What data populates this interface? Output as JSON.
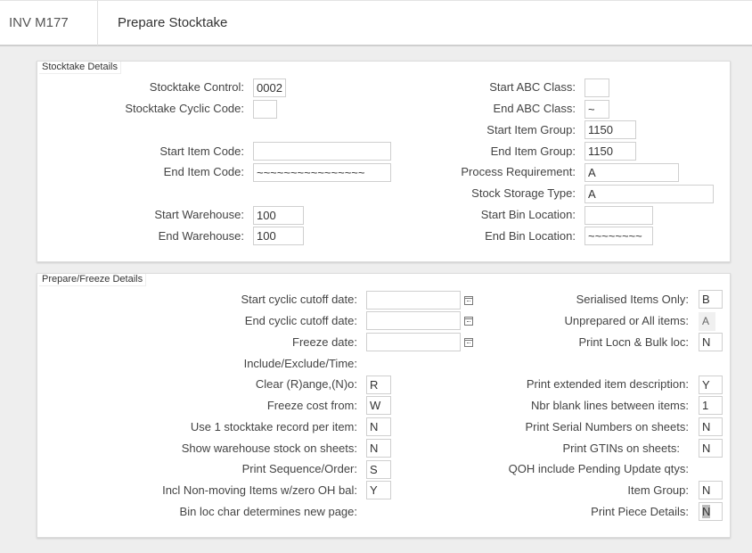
{
  "header": {
    "code": "INV M177",
    "title": "Prepare Stocktake"
  },
  "stocktake": {
    "legend": "Stocktake Details",
    "control_label": "Stocktake Control:",
    "control_value": "0002",
    "cyclic_label": "Stocktake Cyclic Code:",
    "cyclic_value": "",
    "start_item_label": "Start Item Code:",
    "start_item_value": "",
    "end_item_label": "End Item Code:",
    "end_item_value": "~~~~~~~~~~~~~~~~",
    "start_wh_label": "Start Warehouse:",
    "start_wh_value": "100",
    "end_wh_label": "End Warehouse:",
    "end_wh_value": "100",
    "start_abc_label": "Start ABC Class:",
    "start_abc_value": "",
    "end_abc_label": "End ABC Class:",
    "end_abc_value": "~",
    "start_group_label": "Start Item Group:",
    "start_group_value": "1150",
    "end_group_label": "End Item Group:",
    "end_group_value": "1150",
    "process_req_label": "Process Requirement:",
    "process_req_value": "A",
    "storage_type_label": "Stock Storage Type:",
    "storage_type_value": "A",
    "start_bin_label": "Start Bin Location:",
    "start_bin_value": "",
    "end_bin_label": "End Bin Location:",
    "end_bin_value": "~~~~~~~~"
  },
  "prepare": {
    "legend": "Prepare/Freeze Details",
    "start_cutoff_label": "Start cyclic cutoff date:",
    "start_cutoff_value": "",
    "end_cutoff_label": "End cyclic cutoff date:",
    "end_cutoff_value": "",
    "freeze_date_label": "Freeze date:",
    "freeze_date_value": "",
    "include_label": "Include/Exclude/Time:",
    "clear_label": "Clear (R)ange,(N)o:",
    "clear_value": "R",
    "freeze_cost_label": "Freeze cost from:",
    "freeze_cost_value": "W",
    "use1_label": "Use 1 stocktake record per item:",
    "use1_value": "N",
    "show_wh_label": "Show warehouse stock on sheets:",
    "show_wh_value": "N",
    "print_seq_label": "Print Sequence/Order:",
    "print_seq_value": "S",
    "incl_nonmoving_label": "Incl Non-moving Items w/zero OH bal:",
    "incl_nonmoving_value": "Y",
    "bin_loc_label": "Bin loc char determines new page:",
    "serialised_label": "Serialised Items Only:",
    "serialised_value": "B",
    "unprepared_label": "Unprepared or All items:",
    "unprepared_value": "A",
    "print_locn_label": "Print Locn & Bulk loc:",
    "print_locn_value": "N",
    "print_ext_label": "Print extended item description:",
    "print_ext_value": "Y",
    "nbr_blank_label": "Nbr blank lines between items:",
    "nbr_blank_value": "1",
    "print_serial_label": "Print Serial Numbers on sheets:",
    "print_serial_value": "N",
    "print_gtin_label": "Print GTINs on sheets:",
    "print_gtin_value": "N",
    "qoh_label": "QOH include Pending Update qtys:",
    "item_group_label": "Item Group:",
    "item_group_value": "N",
    "print_piece_label": "Print Piece Details:",
    "print_piece_value": "N"
  }
}
